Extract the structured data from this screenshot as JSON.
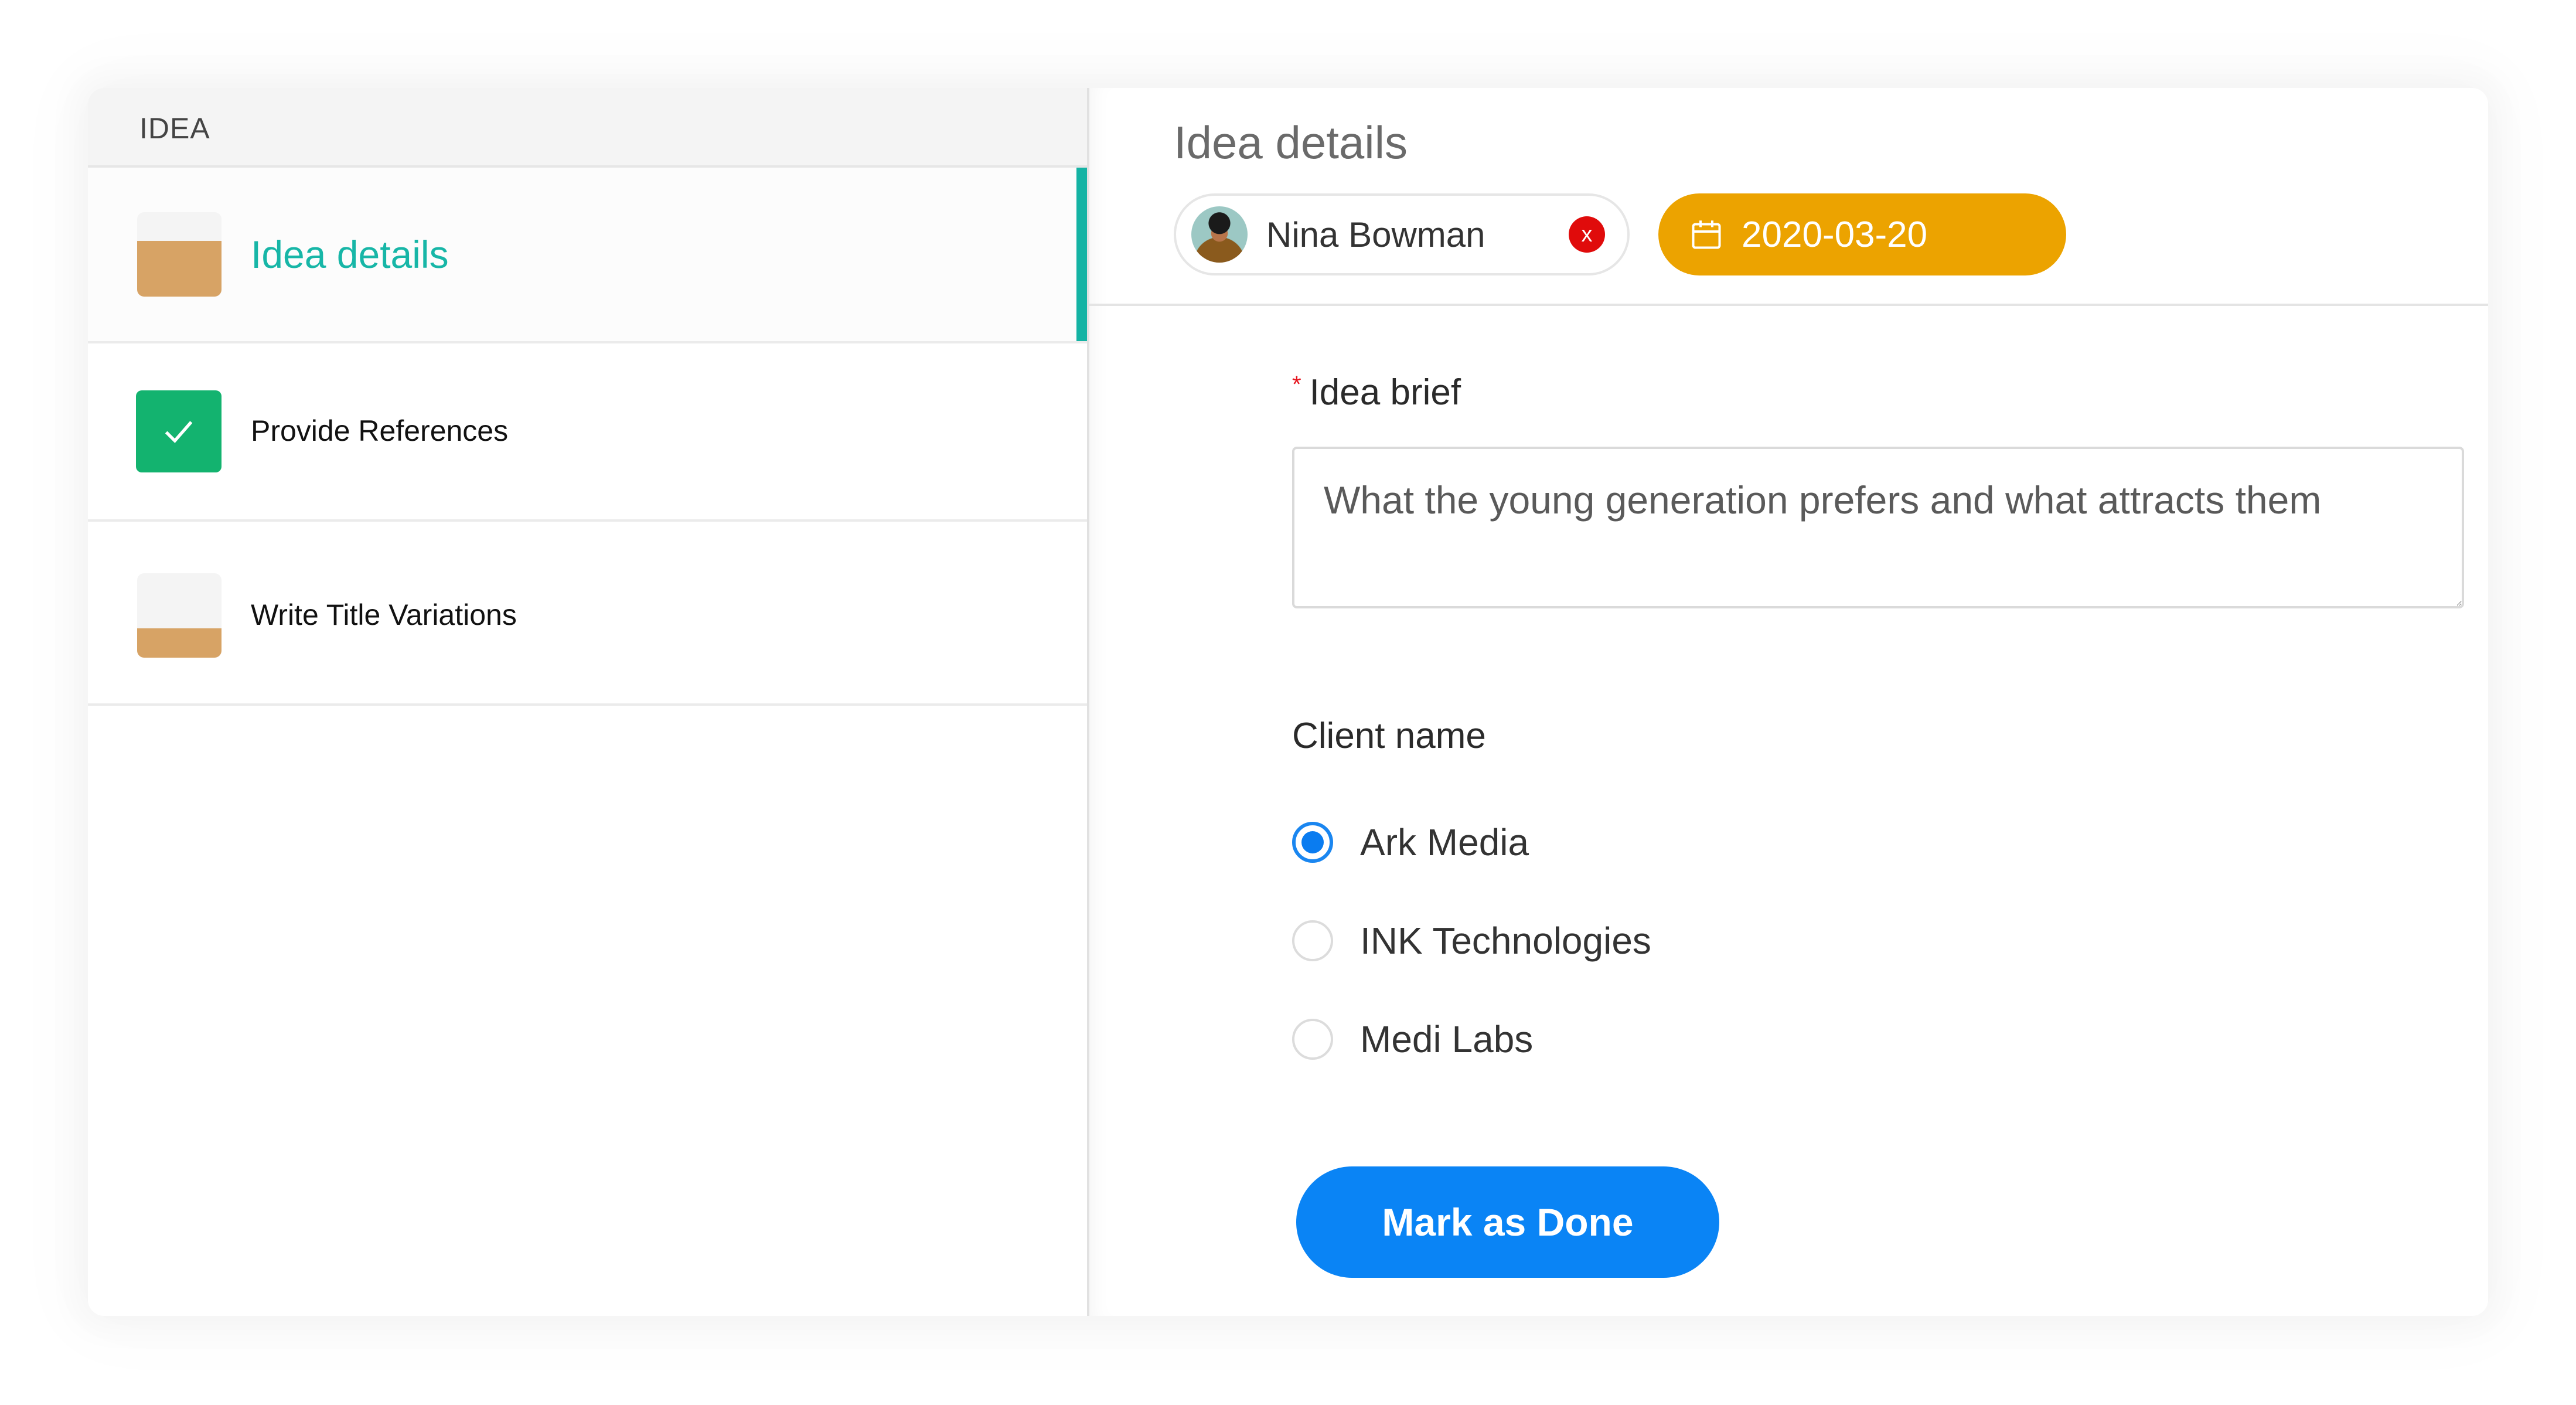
{
  "sidebar": {
    "header": "IDEA",
    "tasks": [
      {
        "label": "Idea details",
        "status": "in-progress",
        "progress": 0.66,
        "active": true
      },
      {
        "label": "Provide References",
        "status": "done",
        "progress": 1.0,
        "active": false
      },
      {
        "label": "Write Title Variations",
        "status": "in-progress",
        "progress": 0.35,
        "active": false
      }
    ]
  },
  "detail": {
    "title": "Idea details",
    "assignee": {
      "name": "Nina Bowman",
      "remove_label": "x"
    },
    "due_date": "2020-03-20",
    "idea_brief": {
      "label": "Idea brief",
      "required_marker": "*",
      "value": "What the young generation prefers and what attracts them"
    },
    "client_name": {
      "label": "Client name",
      "options": [
        {
          "label": "Ark Media",
          "selected": true
        },
        {
          "label": "INK Technologies",
          "selected": false
        },
        {
          "label": "Medi Labs",
          "selected": false
        }
      ]
    },
    "mark_done_label": "Mark as Done"
  },
  "colors": {
    "accent_teal": "#17b6a7",
    "progress_fill": "#d7a365",
    "done_green": "#13b36f",
    "date_chip": "#eca300",
    "primary_button": "#0a84f5",
    "remove_red": "#e00b0b",
    "required_red": "#e6141e"
  }
}
